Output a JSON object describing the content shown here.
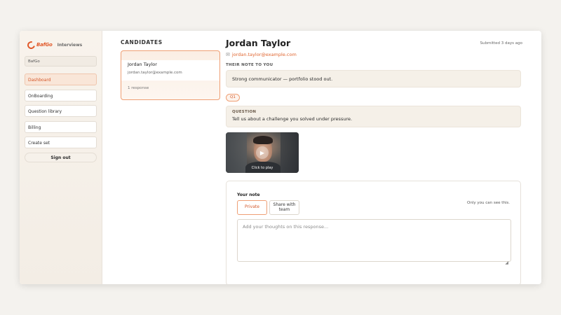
{
  "sidebar": {
    "brand_name": "BafGo",
    "brand_sub": "Interviews",
    "workspace": "BafGo",
    "items": [
      {
        "label": "Dashboard"
      },
      {
        "label": "OnBoarding"
      },
      {
        "label": "Question library"
      },
      {
        "label": "Billing"
      },
      {
        "label": "Create set"
      }
    ],
    "sign_out": "Sign out"
  },
  "candidates": {
    "title": "CANDIDATES",
    "list": [
      {
        "name": "Jordan Taylor",
        "email": "jordan.taylor@example.com",
        "responses": "1 response"
      }
    ]
  },
  "main": {
    "name": "Jordan Taylor",
    "submitted": "Submitted 3 days ago",
    "email": "jordan.taylor@example.com",
    "note_label": "THEIR NOTE TO YOU",
    "note_text": "Strong communicator — portfolio stood out.",
    "question_chip": "Q1",
    "question_label": "QUESTION",
    "question_text": "Tell us about a challenge you solved under pressure.",
    "video_label": "Click to play"
  },
  "your_note": {
    "title": "Your note",
    "private_label": "Private",
    "team_label": "Share with team",
    "visibility_hint": "Only you can see this.",
    "placeholder": "Add your thoughts on this response..."
  },
  "icons": {
    "mail": "mail-icon",
    "play": "play-icon"
  },
  "colors": {
    "accent": "#e0652f",
    "sidebar_bg": "#f8f3ec",
    "panel_bg": "#f5f0e8"
  }
}
